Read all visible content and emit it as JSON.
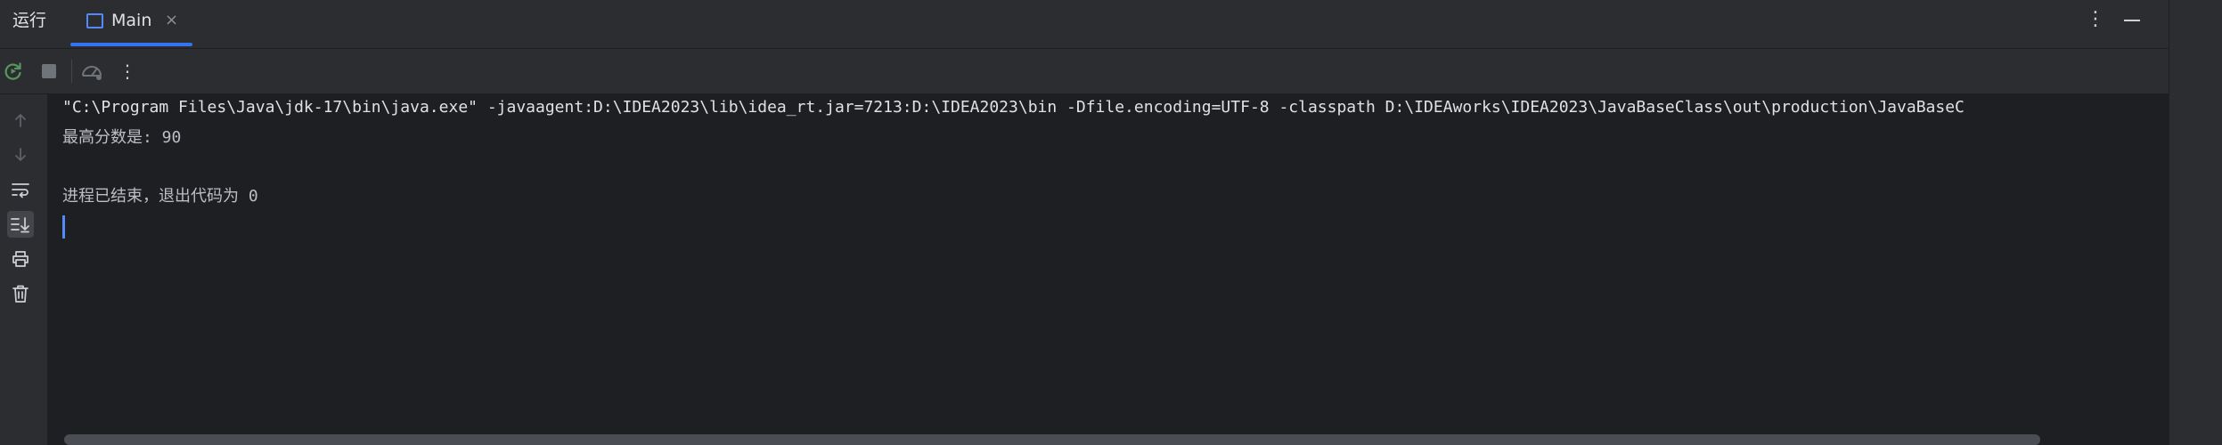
{
  "header": {
    "tool_window_title": "运行",
    "tab": {
      "label": "Main",
      "close_glyph": "×",
      "icon": "console-tab-icon"
    },
    "actions": {
      "more_icon": "more-vertical-icon",
      "more_glyph": "⋮",
      "minimize_icon": "minimize-icon"
    }
  },
  "toolbar": {
    "rerun_icon": "rerun-icon",
    "stop_icon": "stop-icon",
    "attach_icon": "attach-debugger-icon",
    "more_glyph": "⋮"
  },
  "gutter": {
    "buttons": [
      {
        "icon": "arrow-up-icon"
      },
      {
        "icon": "arrow-down-icon"
      },
      {
        "icon": "soft-wrap-icon"
      },
      {
        "icon": "scroll-to-end-icon",
        "active": true
      },
      {
        "icon": "print-icon"
      },
      {
        "icon": "trash-icon"
      }
    ]
  },
  "console": {
    "lines": [
      "\"C:\\Program Files\\Java\\jdk-17\\bin\\java.exe\" -javaagent:D:\\IDEA2023\\lib\\idea_rt.jar=7213:D:\\IDEA2023\\bin -Dfile.encoding=UTF-8 -classpath D:\\IDEAworks\\IDEA2023\\JavaBaseClass\\out\\production\\JavaBaseC",
      "最高分数是: 90",
      "进程已结束，退出代码为 0"
    ]
  },
  "colors": {
    "background": "#2b2d30",
    "console_background": "#1e1f22",
    "accent": "#3574f0",
    "text": "#dfe1e5"
  }
}
